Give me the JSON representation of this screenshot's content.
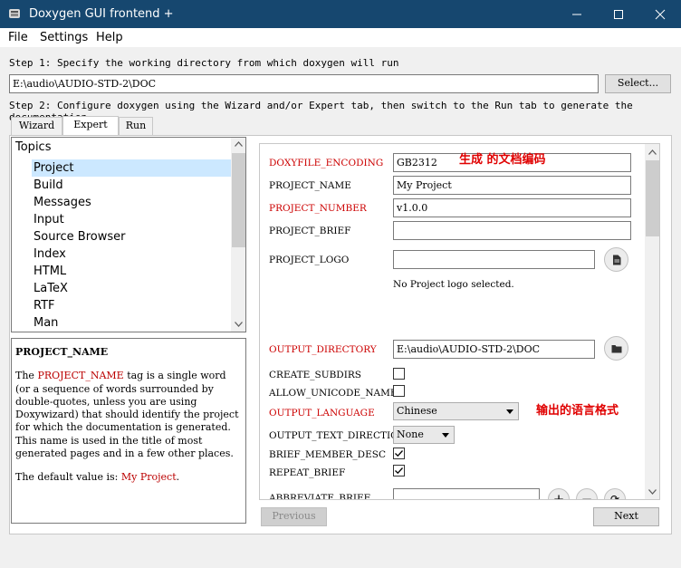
{
  "window": {
    "title": "Doxygen GUI frontend +"
  },
  "menu": [
    "File",
    "Settings",
    "Help"
  ],
  "step1": {
    "label": "Step 1: Specify the working directory from which doxygen will run",
    "path": "E:\\audio\\AUDIO-STD-2\\DOC",
    "select_label": "Select..."
  },
  "step2": {
    "label": "Step 2: Configure doxygen using the Wizard and/or Expert tab, then switch to the Run tab to generate the documentation"
  },
  "tabs": [
    "Wizard",
    "Expert",
    "Run"
  ],
  "topics": {
    "heading": "Topics",
    "items": [
      "Project",
      "Build",
      "Messages",
      "Input",
      "Source Browser",
      "Index",
      "HTML",
      "LaTeX",
      "RTF",
      "Man"
    ]
  },
  "help": {
    "title": "PROJECT_NAME",
    "p1_before": "The ",
    "p1_tag": "PROJECT_NAME",
    "p1_after": " tag is a single word (or a sequence of words surrounded by double-quotes, unless you are using Doxywizard) that should identify the project for which the documentation is generated. This name is used in the title of most generated pages and in a few other places.",
    "p2_before": "The default value is: ",
    "p2_value": "My Project",
    "p2_after": "."
  },
  "fields": {
    "doxyfile_encoding": {
      "label": "DOXYFILE_ENCODING",
      "value": "GB2312"
    },
    "project_name": {
      "label": "PROJECT_NAME",
      "value": "My Project"
    },
    "project_number": {
      "label": "PROJECT_NUMBER",
      "value": "v1.0.0"
    },
    "project_brief": {
      "label": "PROJECT_BRIEF",
      "value": ""
    },
    "project_logo": {
      "label": "PROJECT_LOGO",
      "value": "",
      "note": "No Project logo selected."
    },
    "output_directory": {
      "label": "OUTPUT_DIRECTORY",
      "value": "E:\\audio\\AUDIO-STD-2\\DOC"
    },
    "create_subdirs": {
      "label": "CREATE_SUBDIRS",
      "checked": false
    },
    "allow_unicode_names": {
      "label": "ALLOW_UNICODE_NAMES",
      "checked": false
    },
    "output_language": {
      "label": "OUTPUT_LANGUAGE",
      "value": "Chinese"
    },
    "output_text_direction": {
      "label": "OUTPUT_TEXT_DIRECTION",
      "value": "None"
    },
    "brief_member_desc": {
      "label": "BRIEF_MEMBER_DESC",
      "checked": true
    },
    "repeat_brief": {
      "label": "REPEAT_BRIEF",
      "checked": true
    },
    "abbreviate_brief": {
      "label": "ABBREVIATE_BRIEF",
      "value": ""
    }
  },
  "annotations": {
    "encoding_note": "生成 的文档编码",
    "language_note": "输出的语言格式"
  },
  "nav": {
    "previous": "Previous",
    "next": "Next"
  },
  "colors": {
    "titlebar": "#16476f",
    "required_label": "#cc0000",
    "annotation": "#e00000",
    "selection": "#cce8ff"
  }
}
